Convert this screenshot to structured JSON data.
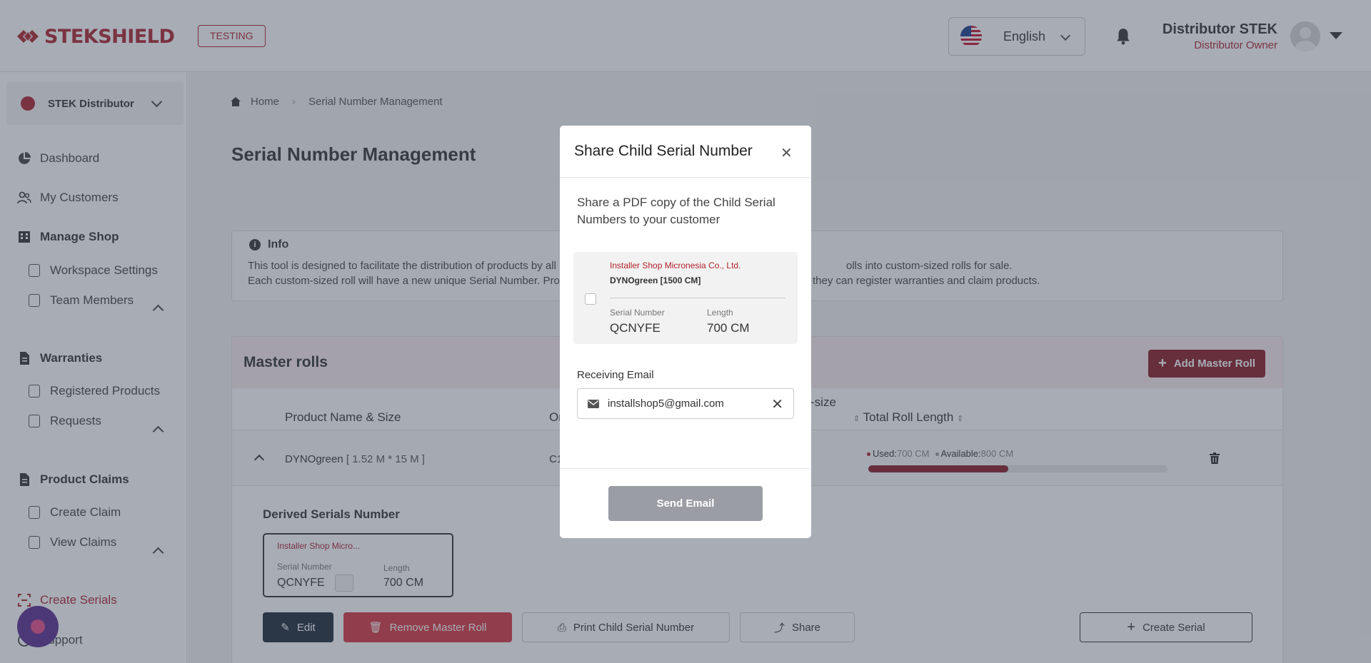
{
  "header": {
    "brand": "STEKSHIELD",
    "env_badge": "TESTING",
    "language": "English",
    "user_name": "Distributor STEK",
    "user_role": "Distributor Owner"
  },
  "sidebar": {
    "distributor": "STEK Distributor",
    "items": [
      {
        "label": "Dashboard"
      },
      {
        "label": "My Customers"
      },
      {
        "label": "Manage Shop"
      },
      {
        "label": "Workspace Settings"
      },
      {
        "label": "Team Members"
      },
      {
        "label": "Warranties"
      },
      {
        "label": "Registered Products"
      },
      {
        "label": "Requests"
      },
      {
        "label": "Product Claims"
      },
      {
        "label": "Create Claim"
      },
      {
        "label": "View Claims"
      },
      {
        "label": "Create Serials"
      },
      {
        "label": "Support"
      }
    ]
  },
  "breadcrumb": {
    "home": "Home",
    "current": "Serial Number Management"
  },
  "page": {
    "title": "Serial Number Management"
  },
  "info": {
    "title": "Info",
    "line1": "This tool is designed to facilitate the distribution of products by all",
    "line1_end": "olls into custom-sized rolls for sale.",
    "line2": "Each custom-sized roll will have a new unique Serial Number. Prov",
    "line2_end": "they can register warranties and claim products."
  },
  "rolls": {
    "title": "Master rolls",
    "add_button": "Add Master Roll",
    "columns": {
      "product": "Product Name & Size",
      "origin": "Or",
      "size": "-size",
      "total": "Total Roll Length"
    },
    "row": {
      "product": "DYNOgreen",
      "size": "[ 1.52 M * 15 M ]",
      "code": "C1",
      "used_label": "Used:",
      "used": "700 CM",
      "available_label": "Available:",
      "available": "800 CM",
      "used_fraction": 0.4667
    },
    "derived": {
      "title": "Derived Serials Number",
      "shop": "Installer Shop Micro...",
      "serial_label": "Serial Number",
      "serial": "QCNYFE",
      "length_label": "Length",
      "length": "700 CM"
    },
    "actions": {
      "edit": "Edit",
      "remove": "Remove Master Roll",
      "print": "Print Child Serial Number",
      "share": "Share",
      "create": "Create Serial"
    }
  },
  "modal": {
    "title": "Share Child Serial Number",
    "description": "Share a PDF copy of the Child Serial Numbers to your customer",
    "card": {
      "shop": "Installer Shop Micronesia Co., Ltd.",
      "product": "DYNOgreen [1500 CM]",
      "serial_label": "Serial Number",
      "serial": "QCNYFE",
      "length_label": "Length",
      "length": "700 CM"
    },
    "email_label": "Receiving Email",
    "email_value": "installshop5@gmail.com",
    "send_button": "Send Email"
  },
  "colors": {
    "brand": "#b0242d",
    "dark_red": "#8a1c24",
    "overlay": "rgba(60,70,90,0.45)"
  }
}
